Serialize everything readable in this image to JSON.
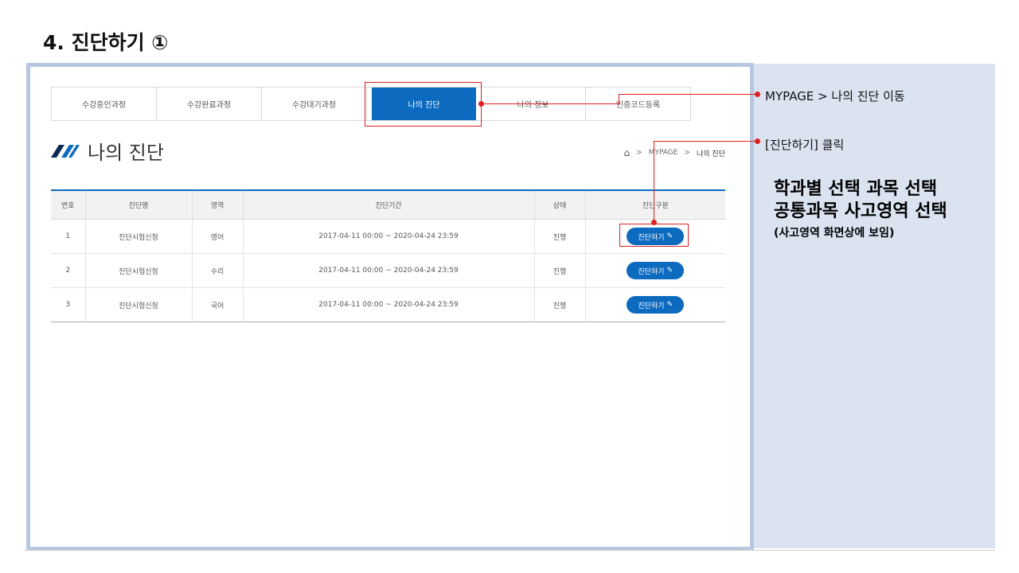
{
  "slide": {
    "title": "4. 진단하기 ①"
  },
  "tabs": [
    {
      "label": "수강중인과정",
      "active": false
    },
    {
      "label": "수강완료과정",
      "active": false
    },
    {
      "label": "수강대기과정",
      "active": false
    },
    {
      "label": "나의 진단",
      "active": true
    },
    {
      "label": "나의 정보",
      "active": false
    },
    {
      "label": "인증코드등록",
      "active": false
    }
  ],
  "page": {
    "heading": "나의 진단"
  },
  "breadcrumb": {
    "level1": "MYPAGE",
    "level2": "나의 진단",
    "separator": ">"
  },
  "table": {
    "headers": [
      "번호",
      "진단명",
      "영역",
      "진단기간",
      "상태",
      "진단구분"
    ],
    "rows": [
      {
        "no": "1",
        "name": "진단시험신청",
        "area": "영어",
        "period": "2017-04-11 00:00 ~ 2020-04-24 23:59",
        "status": "진행",
        "action": "진단하기"
      },
      {
        "no": "2",
        "name": "진단시험신청",
        "area": "수리",
        "period": "2017-04-11 00:00 ~ 2020-04-24 23:59",
        "status": "진행",
        "action": "진단하기"
      },
      {
        "no": "3",
        "name": "진단시험신청",
        "area": "국어",
        "period": "2017-04-11 00:00 ~ 2020-04-24 23:59",
        "status": "진행",
        "action": "진단하기"
      }
    ]
  },
  "annotations": {
    "note1": "MYPAGE > 나의 진단 이동",
    "note2": "[진단하기] 클릭",
    "big_line1": "학과별 선택 과목 선택",
    "big_line2": "공통과목 사고영역 선택",
    "small_line": "(사고영역 화면상에 보임)"
  },
  "colors": {
    "accent": "#0c6abf",
    "annotation": "#e02020",
    "side_panel": "#dbe3f1",
    "frame": "#b8c7e0"
  }
}
